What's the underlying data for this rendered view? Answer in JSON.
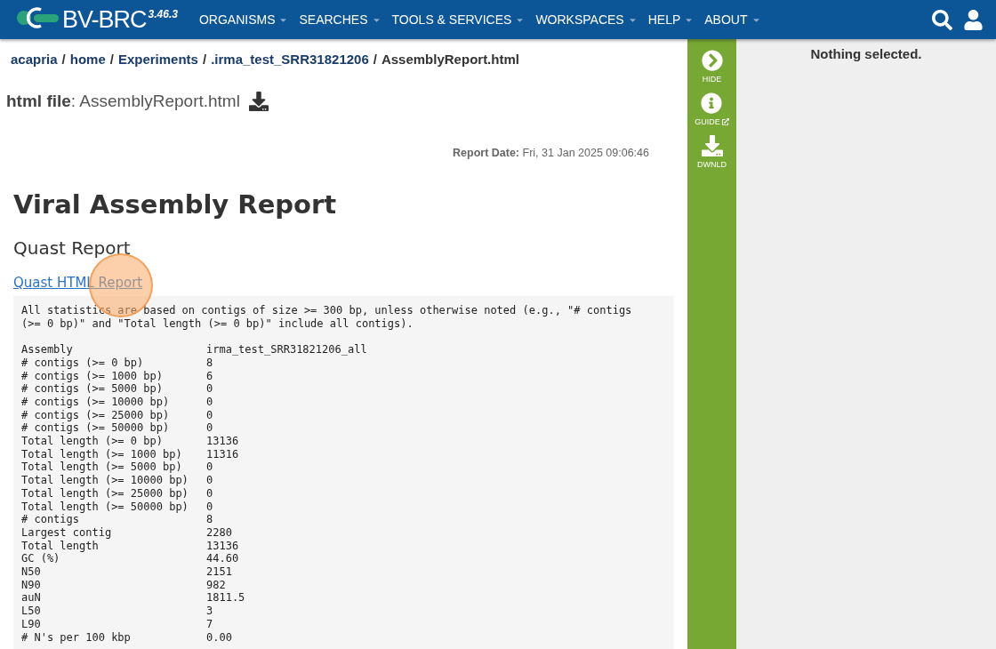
{
  "header": {
    "logo": "BV-BRC",
    "version": "3.46.3",
    "nav": [
      {
        "label": "ORGANISMS"
      },
      {
        "label": "SEARCHES"
      },
      {
        "label": "TOOLS & SERVICES"
      },
      {
        "label": "WORKSPACES"
      },
      {
        "label": "HELP"
      },
      {
        "label": "ABOUT"
      }
    ]
  },
  "breadcrumb": [
    {
      "label": "acapria"
    },
    {
      "separator": "/",
      "label": "home"
    },
    {
      "separator": "/",
      "label": "Experiments"
    },
    {
      "separator": "/",
      "label": ".irma_test_SRR31821206"
    },
    {
      "separator": "/",
      "label": "AssemblyReport.html"
    }
  ],
  "file": {
    "text": "**html file**: AssemblyReport.html"
  },
  "report": {
    "date_label": "Report Date:",
    "date": "Fri, 31 Jan 2025 09:06:46",
    "title": "Viral Assembly Report",
    "subtitle": "Quast Report",
    "link": "Quast HTML Report",
    "click_highlight": true,
    "note": "All statistics are based on contigs of size >= 300 bp, unless otherwise noted (e.g., \"# contigs (>= 0 bp)\" and \"Total length (>= 0 bp)\" include all contigs).",
    "rows": [
      {
        "label": "Assembly",
        "value": "irma_test_SRR31821206_all"
      },
      {
        "label": "# contigs (>= 0 bp)",
        "value": "8"
      },
      {
        "label": "# contigs (>= 1000 bp)",
        "value": "6"
      },
      {
        "label": "# contigs (>= 5000 bp)",
        "value": "0"
      },
      {
        "label": "# contigs (>= 10000 bp)",
        "value": "0"
      },
      {
        "label": "# contigs (>= 25000 bp)",
        "value": "0"
      },
      {
        "label": "# contigs (>= 50000 bp)",
        "value": "0"
      },
      {
        "label": "Total length (>= 0 bp)",
        "value": "13136"
      },
      {
        "label": "Total length (>= 1000 bp)",
        "value": "11316"
      },
      {
        "label": "Total length (>= 5000 bp)",
        "value": "0"
      },
      {
        "label": "Total length (>= 10000 bp)",
        "value": "0"
      },
      {
        "label": "Total length (>= 25000 bp)",
        "value": "0"
      },
      {
        "label": "Total length (>= 50000 bp)",
        "value": "0"
      },
      {
        "label": "# contigs",
        "value": "8"
      },
      {
        "label": "Largest contig",
        "value": "2280"
      },
      {
        "label": "Total length",
        "value": "13136"
      },
      {
        "label": "GC (%)",
        "value": "44.60"
      },
      {
        "label": "N50",
        "value": "2151"
      },
      {
        "label": "N90",
        "value": "982"
      },
      {
        "label": "auN",
        "value": "1811.5"
      },
      {
        "label": "L50",
        "value": "3"
      },
      {
        "label": "L90",
        "value": "7"
      },
      {
        "label": "# N's per 100 kbp",
        "value": "0.00"
      }
    ]
  },
  "action_bar": [
    {
      "kind": "hide",
      "label": "HIDE"
    },
    {
      "kind": "guide",
      "label": "GUIDE"
    },
    {
      "kind": "download",
      "label": "DWNLD"
    }
  ],
  "details": {
    "message": "Nothing selected."
  }
}
